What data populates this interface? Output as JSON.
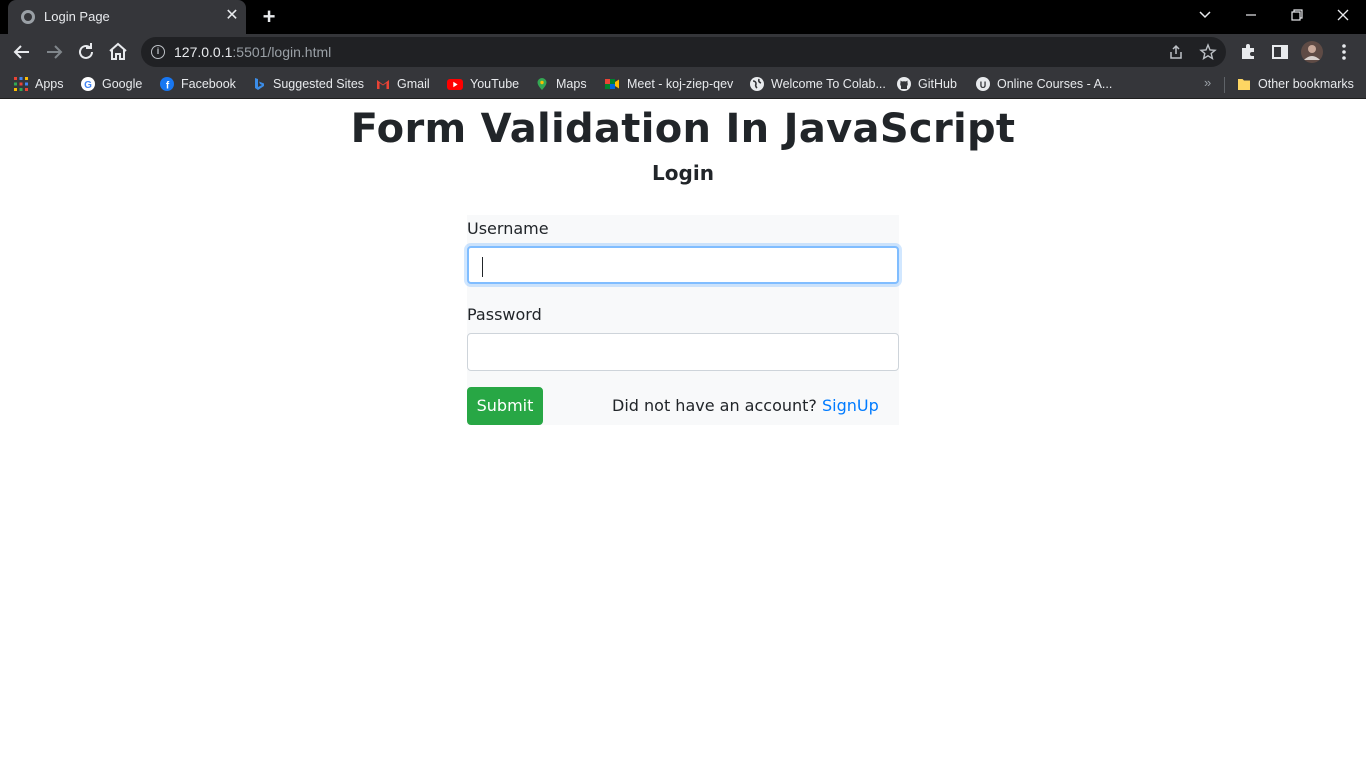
{
  "browser": {
    "tab": {
      "title": "Login Page",
      "close": "✕"
    },
    "new_tab": "+",
    "url": {
      "host": "127.0.0.1",
      "rest": ":5501/login.html"
    },
    "bookmarks": [
      {
        "label": "Apps",
        "icon": "apps-grid-icon"
      },
      {
        "label": "Google",
        "icon": "google-icon"
      },
      {
        "label": "Facebook",
        "icon": "facebook-icon"
      },
      {
        "label": "Suggested Sites",
        "icon": "bing-icon"
      },
      {
        "label": "Gmail",
        "icon": "gmail-icon"
      },
      {
        "label": "YouTube",
        "icon": "youtube-icon"
      },
      {
        "label": "Maps",
        "icon": "maps-icon"
      },
      {
        "label": "Meet - koj-ziep-qev",
        "icon": "meet-icon"
      },
      {
        "label": "Welcome To Colab...",
        "icon": "globe-icon"
      },
      {
        "label": "GitHub",
        "icon": "github-icon"
      },
      {
        "label": "Online Courses - A...",
        "icon": "courses-icon"
      }
    ],
    "bookmarks_more": "»",
    "other_bookmarks": "Other bookmarks"
  },
  "page": {
    "heading": "Form Validation In JavaScript",
    "subheading": "Login",
    "form": {
      "username_label": "Username",
      "username_value": "",
      "password_label": "Password",
      "password_value": "",
      "submit_label": "Submit",
      "signup_prompt": "Did not have an account?",
      "signup_link": "SignUp"
    }
  },
  "colors": {
    "submit": "#28a745",
    "link": "#007bff",
    "focus_border": "#80bdff",
    "form_bg": "#f8f9fa"
  }
}
